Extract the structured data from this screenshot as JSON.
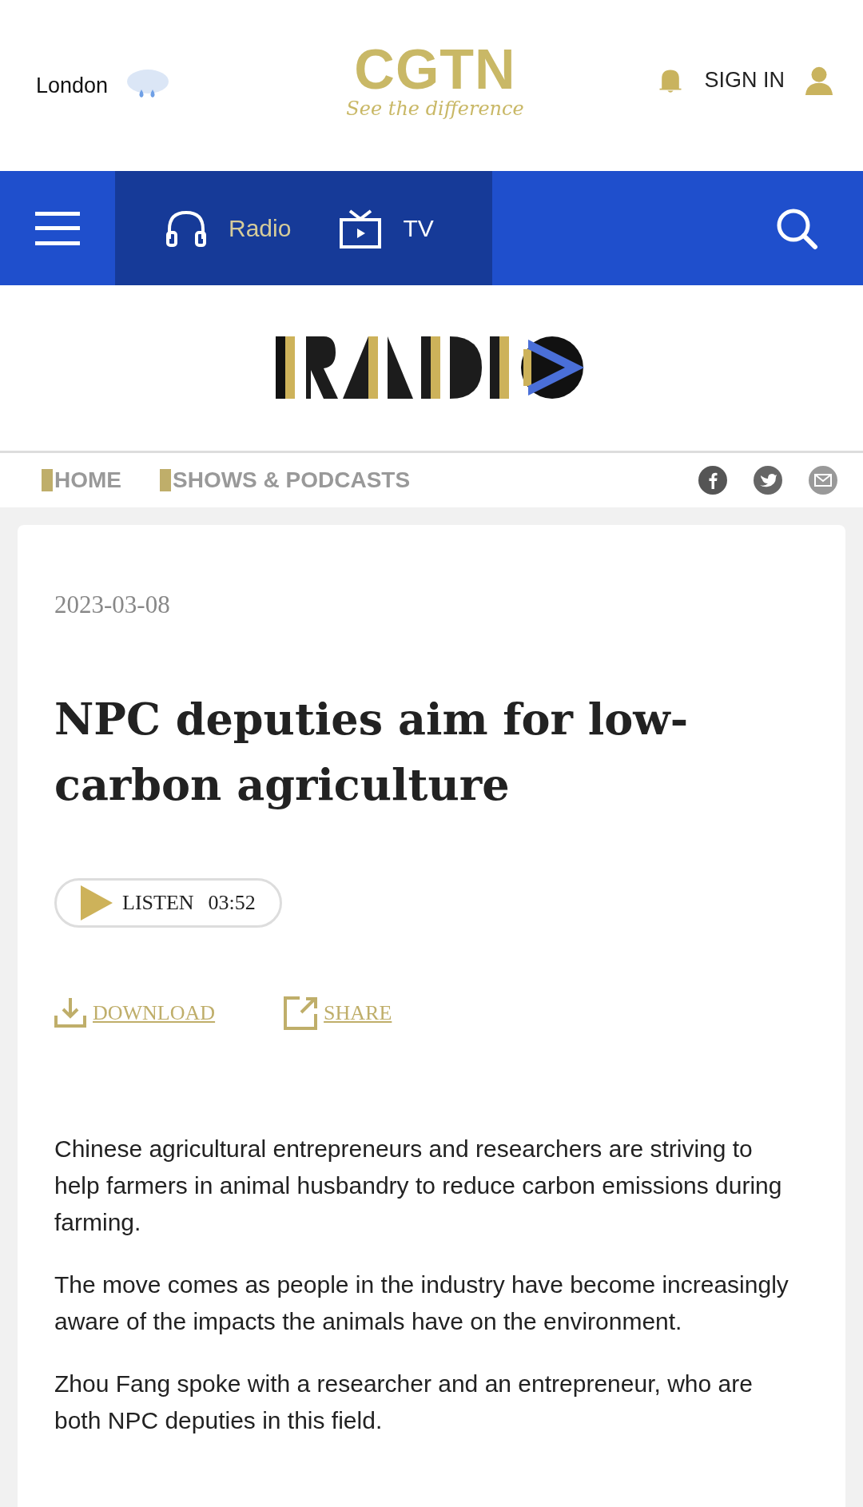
{
  "header": {
    "city": "London",
    "logo": {
      "name": "CGTN",
      "tagline": "See the difference"
    },
    "sign_in": "SIGN IN"
  },
  "nav": {
    "items": [
      {
        "label": "Radio",
        "kind": "radio",
        "selected": true
      },
      {
        "label": "TV",
        "kind": "tv",
        "selected": false
      }
    ]
  },
  "subnav": {
    "links": [
      "HOME",
      "SHOWS & PODCASTS"
    ],
    "share": [
      {
        "kind": "facebook"
      },
      {
        "kind": "twitter"
      },
      {
        "kind": "email"
      }
    ]
  },
  "article": {
    "date": "2023-03-08",
    "title": "NPC deputies aim for low-carbon agriculture",
    "listen": {
      "label": "LISTEN",
      "duration": "03:52"
    },
    "download": "DOWNLOAD",
    "share": "SHARE",
    "paragraphs": [
      "Chinese agricultural entrepreneurs and researchers are striving to help farmers in animal husbandry to reduce carbon emissions during farming.",
      "The move comes as people in the industry have become increasingly aware of the impacts the animals have on the environment.",
      "Zhou Fang spoke with a researcher and an entrepreneur, who are both NPC deputies in this field."
    ]
  }
}
